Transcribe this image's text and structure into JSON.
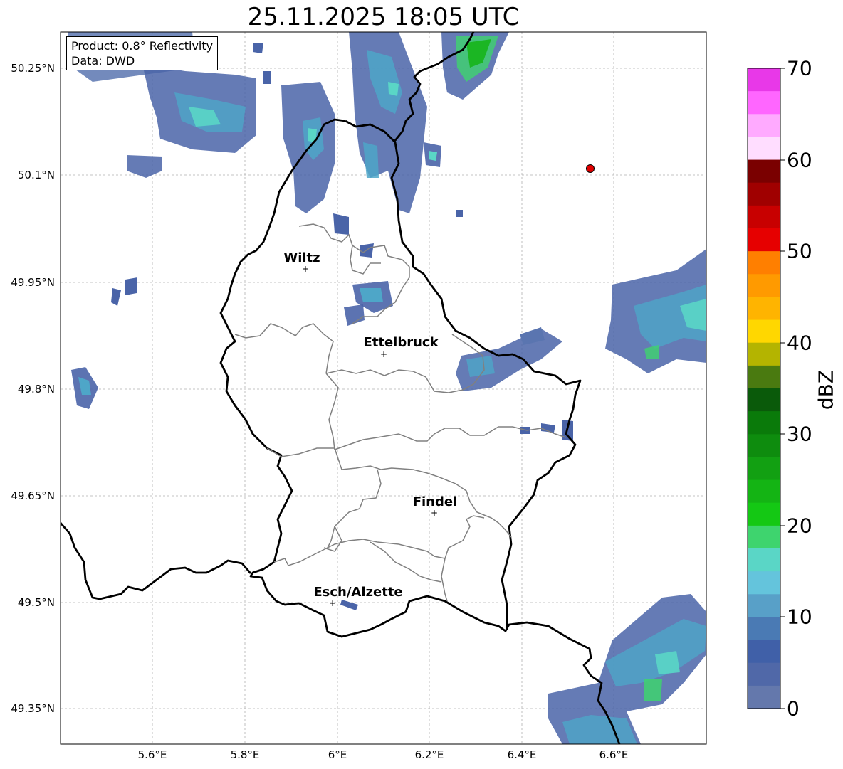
{
  "title": "25.11.2025 18:05 UTC",
  "info": {
    "product": "Product: 0.8° Reflectivity",
    "data": "Data: DWD"
  },
  "axes": {
    "lat_labels": [
      "50.25°N",
      "50.1°N",
      "49.95°N",
      "49.8°N",
      "49.65°N",
      "49.5°N",
      "49.35°N"
    ],
    "lon_labels": [
      "5.6°E",
      "5.8°E",
      "6°E",
      "6.2°E",
      "6.4°E",
      "6.6°E"
    ]
  },
  "cities": [
    {
      "name": "Wiltz"
    },
    {
      "name": "Ettelbruck"
    },
    {
      "name": "Findel"
    },
    {
      "name": "Esch/Alzette"
    }
  ],
  "colorbar": {
    "title": "dBZ",
    "tick_labels": [
      "70",
      "60",
      "50",
      "40",
      "30",
      "20",
      "10",
      "0"
    ],
    "colors": [
      "#e838e8",
      "#ff66ff",
      "#ffaaff",
      "#ffddff",
      "#7a0000",
      "#a00000",
      "#c80000",
      "#e60000",
      "#ff7f00",
      "#ff9a00",
      "#ffb400",
      "#ffd700",
      "#b4b400",
      "#4a7a10",
      "#0a5a0a",
      "#0a7a0a",
      "#0e8c0e",
      "#12a012",
      "#14b414",
      "#14c814",
      "#3ed46e",
      "#5ad6c6",
      "#64c4dc",
      "#58a0c8",
      "#4a7ab4",
      "#4060a8",
      "#5068a8",
      "#6478ac"
    ]
  },
  "colors": {
    "border": "#000000",
    "canton": "#808080",
    "grid": "#b0b0b0",
    "radar_dot": "#e00000"
  }
}
